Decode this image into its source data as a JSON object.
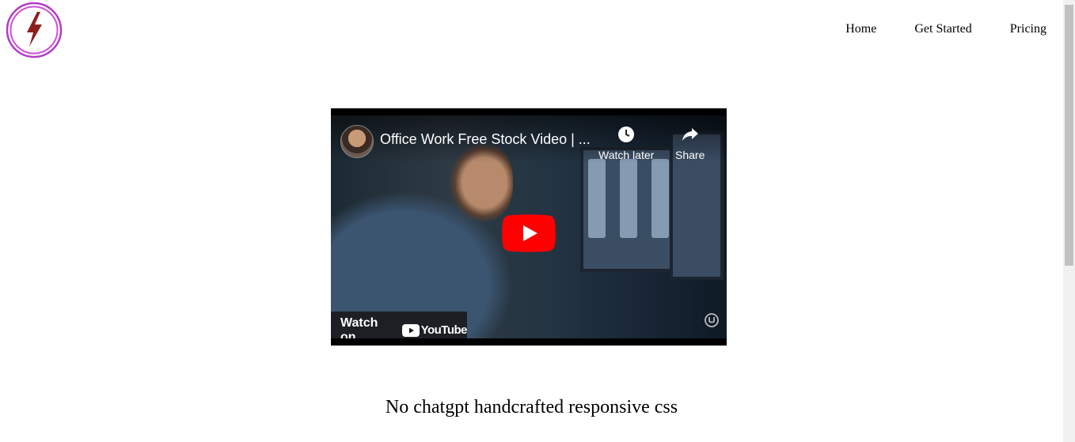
{
  "brand": {
    "logo_icon": "lightning-bolt-icon",
    "ring_color": "#b23cc8",
    "bolt_color": "#8e1f1f"
  },
  "nav": {
    "items": [
      "Home",
      "Get Started",
      "Pricing"
    ]
  },
  "video": {
    "title": "Office Work Free Stock Video | ...",
    "watch_later_label": "Watch later",
    "share_label": "Share",
    "watch_on_label": "Watch on",
    "youtube_label": "YouTube",
    "play_color": "#ff0000"
  },
  "caption": "No chatgpt handcrafted responsive css"
}
